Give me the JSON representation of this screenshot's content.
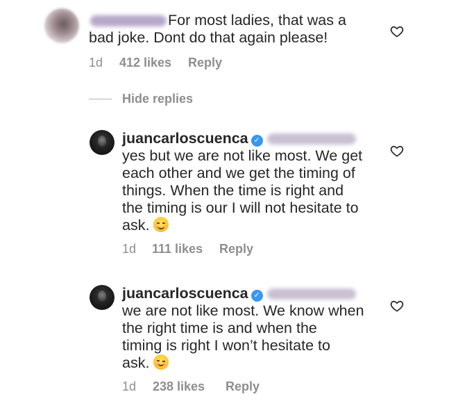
{
  "comments": [
    {
      "text_line1": "For most ladies, that was a",
      "text_line2": "bad joke. Dont do that again please!",
      "time": "1d",
      "likes": "412 likes",
      "reply": "Reply"
    },
    {
      "username": "juancarloscuenca",
      "lines": [
        "yes but we are not like most. We get",
        "each other and we get the timing of",
        "things. When the time is right and",
        "the timing is our I will not hesitate to",
        "ask."
      ],
      "emoji": "smiling-face-icon",
      "time": "1d",
      "likes": "111 likes",
      "reply": "Reply"
    },
    {
      "username": "juancarloscuenca",
      "lines": [
        "we are not like most. We know when",
        "the right time is and when the",
        "timing is right I won’t hesitate to",
        "ask."
      ],
      "emoji": "winking-face-icon",
      "time": "1d",
      "likes": "238 likes",
      "reply": "Reply"
    }
  ],
  "hide_replies": "Hide replies",
  "colors": {
    "text": "#262626",
    "meta": "#8e8e8e",
    "verified": "#3897f0"
  }
}
